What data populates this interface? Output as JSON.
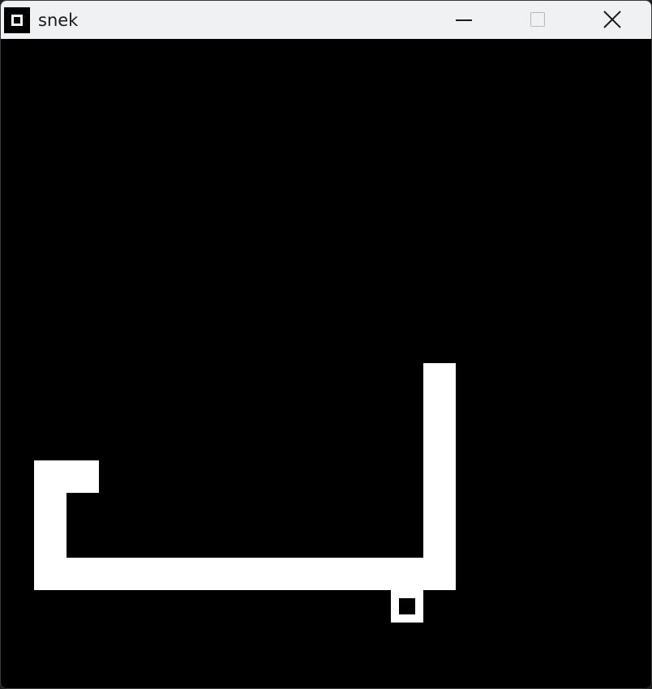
{
  "window": {
    "title": "snek",
    "icons": {
      "app": "snake-app-icon",
      "minimize": "minimize-icon",
      "maximize": "maximize-icon",
      "close": "close-icon"
    },
    "maximize_enabled": false
  },
  "colors": {
    "background": "#000000",
    "snake": "#ffffff",
    "food": "#ffffff",
    "titlebar": "#eff1f3"
  },
  "game": {
    "grid_columns": 20,
    "grid_rows": 20,
    "snake": [
      [
        13,
        10
      ],
      [
        13,
        11
      ],
      [
        13,
        12
      ],
      [
        13,
        13
      ],
      [
        13,
        14
      ],
      [
        13,
        15
      ],
      [
        13,
        16
      ],
      [
        12,
        16
      ],
      [
        11,
        16
      ],
      [
        10,
        16
      ],
      [
        9,
        16
      ],
      [
        8,
        16
      ],
      [
        7,
        16
      ],
      [
        6,
        16
      ],
      [
        5,
        16
      ],
      [
        4,
        16
      ],
      [
        3,
        16
      ],
      [
        2,
        16
      ],
      [
        1,
        16
      ],
      [
        1,
        15
      ],
      [
        1,
        14
      ],
      [
        1,
        13
      ],
      [
        2,
        13
      ]
    ],
    "food": [
      12,
      17
    ]
  }
}
